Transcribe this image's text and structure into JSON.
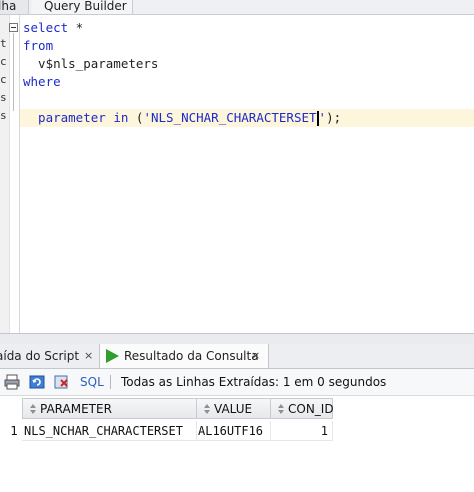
{
  "top_tabs": {
    "worksheet": "lha",
    "query_builder": "Query Builder"
  },
  "editor": {
    "lines": {
      "l1_kw": "select",
      "l1_rest": " *",
      "l2_kw": "from",
      "l3": "  v$nls_parameters",
      "l4_kw": "where",
      "l5_ident": "  parameter",
      "l5_kw": " in",
      "l5_open": " (",
      "l5_str": "'NLS_NCHAR_CHARACTERSET",
      "l5_str_end": "'",
      "l5_close": ");"
    },
    "gutter_marks": [
      "t",
      "c",
      "c",
      "s",
      "s"
    ]
  },
  "bottom_tabs": {
    "script_output": "aída do Script",
    "query_result": "Resultado da Consulta",
    "close_glyph": "×"
  },
  "toolbar": {
    "sql_label": "SQL",
    "status_text": "Todas as Linhas Extraídas: 1 em 0 segundos"
  },
  "grid": {
    "columns": [
      "PARAMETER",
      "VALUE",
      "CON_ID"
    ],
    "rows": [
      {
        "num": "1",
        "parameter": "NLS_NCHAR_CHARACTERSET",
        "value": "AL16UTF16",
        "con_id": "1"
      }
    ]
  },
  "colors": {
    "keyword": "#1d2bc9",
    "current_line": "#fdf5dc",
    "play_icon": "#2e9e2e"
  }
}
